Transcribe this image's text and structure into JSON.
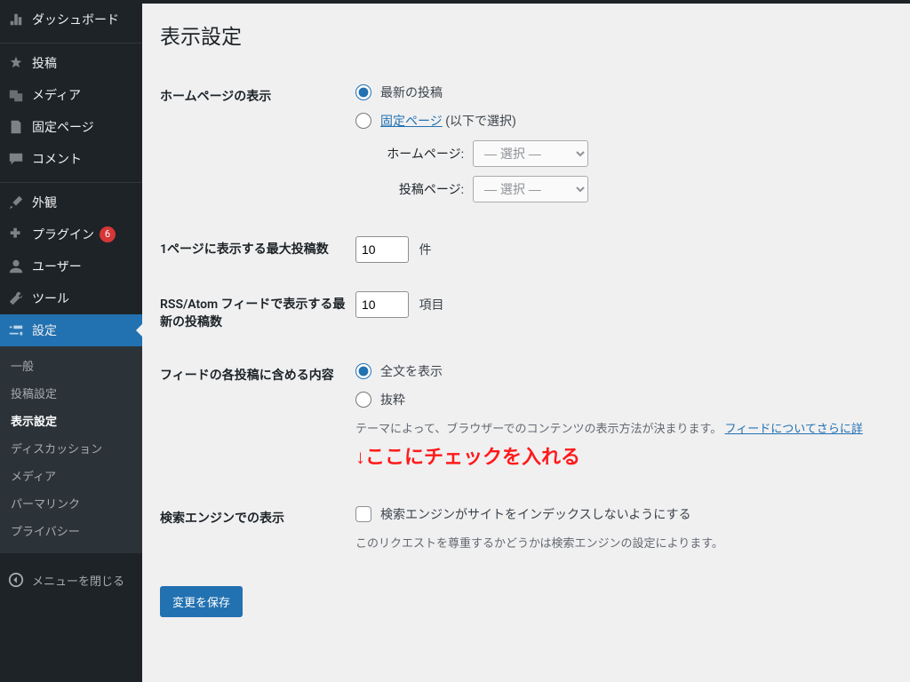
{
  "sidebar": {
    "dashboard": "ダッシュボード",
    "posts": "投稿",
    "media": "メディア",
    "pages": "固定ページ",
    "comments": "コメント",
    "appearance": "外観",
    "plugins": "プラグイン",
    "plugins_badge": "6",
    "users": "ユーザー",
    "tools": "ツール",
    "settings": "設定",
    "sub_general": "一般",
    "sub_writing": "投稿設定",
    "sub_reading": "表示設定",
    "sub_discussion": "ディスカッション",
    "sub_media": "メディア",
    "sub_permalink": "パーマリンク",
    "sub_privacy": "プライバシー",
    "collapse": "メニューを閉じる"
  },
  "page": {
    "title": "表示設定",
    "homepage_label": "ホームページの表示",
    "radio_latest": "最新の投稿",
    "radio_static_link": "固定ページ",
    "radio_static_suffix": " (以下で選択)",
    "homepage_select_label": "ホームページ:",
    "posts_page_select_label": "投稿ページ:",
    "select_placeholder": "— 選択 —",
    "posts_per_page_label": "1ページに表示する最大投稿数",
    "posts_per_page_value": "10",
    "posts_per_page_unit": "件",
    "feed_items_label": "RSS/Atom フィードで表示する最新の投稿数",
    "feed_items_value": "10",
    "feed_items_unit": "項目",
    "feed_content_label": "フィードの各投稿に含める内容",
    "radio_full": "全文を表示",
    "radio_excerpt": "抜粋",
    "feed_description_prefix": "テーマによって、ブラウザーでのコンテンツの表示方法が決まります。",
    "feed_description_link": "フィードについてさらに詳",
    "annotation": "↓ここにチェックを入れる",
    "search_engine_label": "検索エンジンでの表示",
    "search_engine_checkbox": "検索エンジンがサイトをインデックスしないようにする",
    "search_engine_description": "このリクエストを尊重するかどうかは検索エンジンの設定によります。",
    "submit": "変更を保存"
  }
}
